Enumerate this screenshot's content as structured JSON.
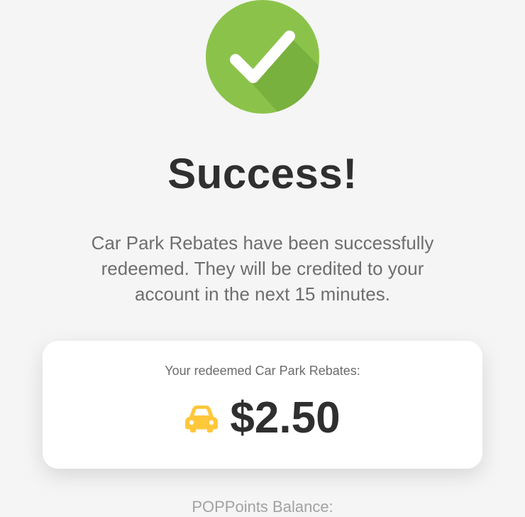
{
  "success": {
    "title": "Success!",
    "message": "Car Park Rebates have been successfully redeemed. They will be credited to your account in the next 15 minutes."
  },
  "rebate_card": {
    "label": "Your redeemed Car Park Rebates:",
    "amount": "$2.50",
    "icon": "car-icon"
  },
  "pop_points": {
    "label": "POPPoints Balance:"
  },
  "colors": {
    "success_green": "#8bc34a",
    "success_green_shadow": "#6aa233",
    "car_yellow": "#ffc73a",
    "text_dark": "#2f2f2f",
    "text_muted": "#6e6e6e",
    "text_light": "#a2a2a2",
    "background": "#f5f5f5",
    "card_background": "#ffffff"
  }
}
